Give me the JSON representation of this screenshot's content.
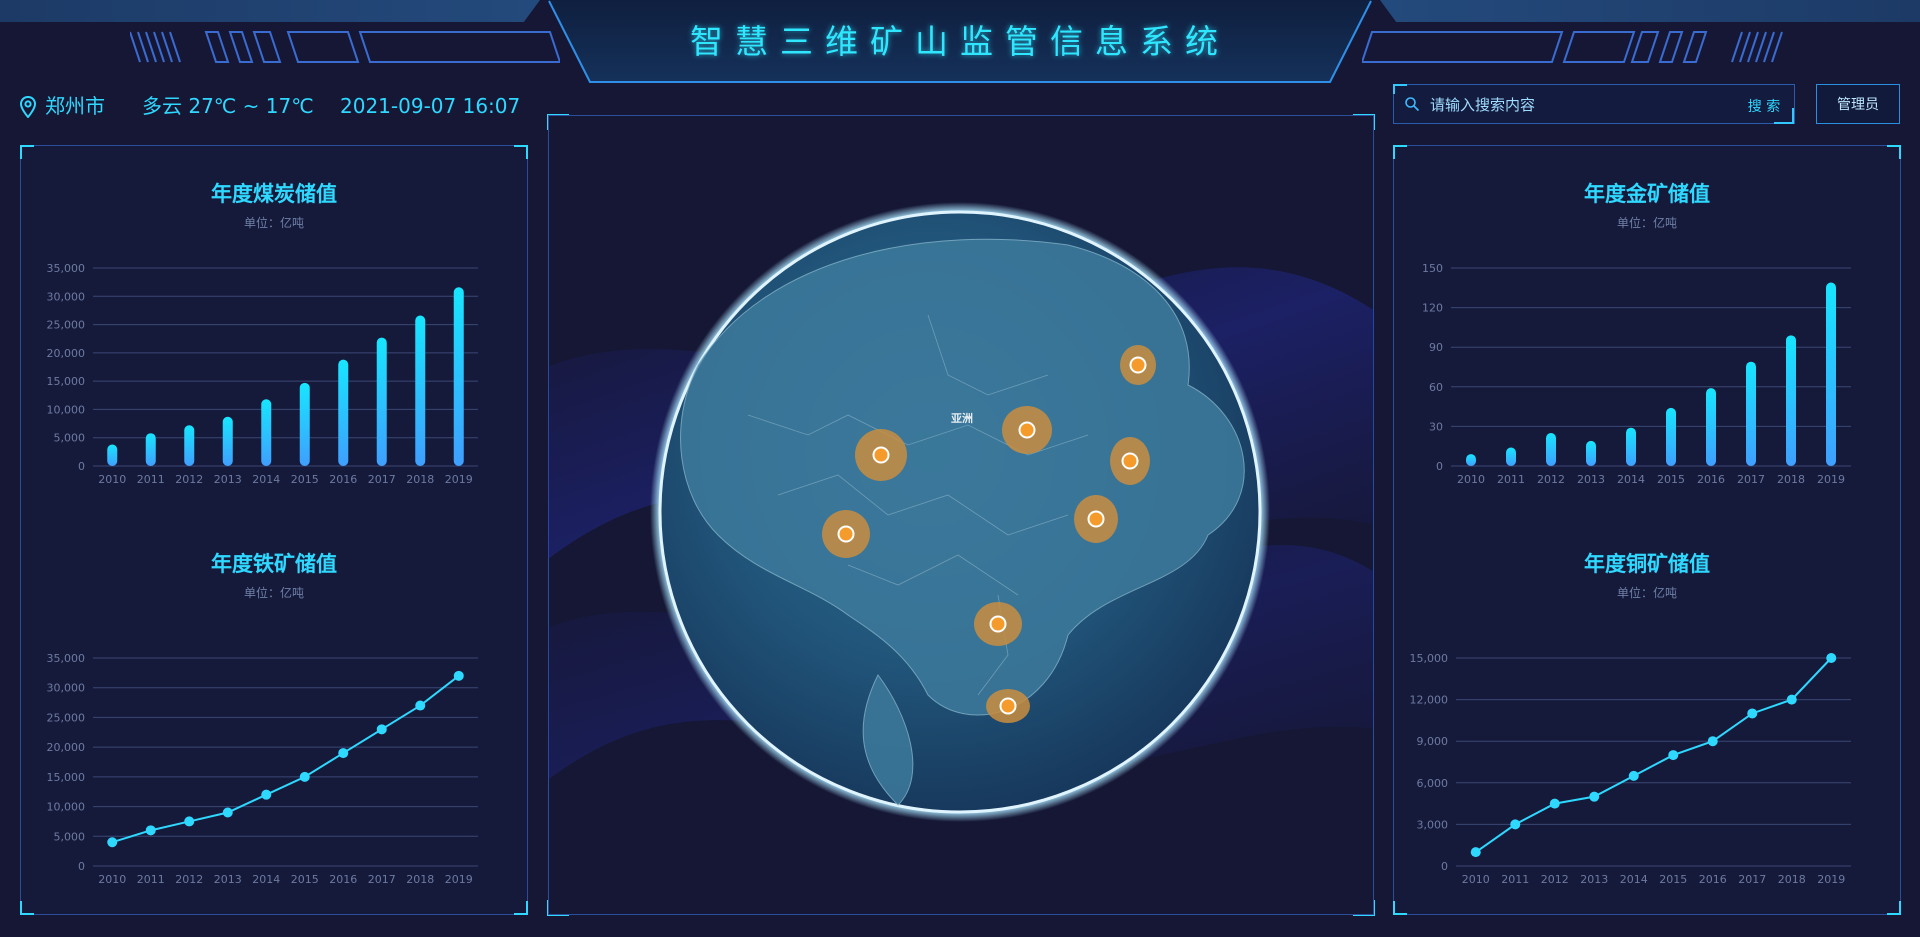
{
  "header": {
    "title": "智慧三维矿山监管信息系统"
  },
  "info": {
    "city": "郑州市",
    "weather": "多云 27℃ ~ 17℃",
    "datetime": "2021-09-07 16:07"
  },
  "search": {
    "placeholder": "请输入搜索内容",
    "button_label": "搜 索"
  },
  "admin": {
    "label": "管理员"
  },
  "globe": {
    "label": "亚洲",
    "marker_count": 8
  },
  "colors": {
    "accent": "#2fd8ff",
    "bar_top": "#17e6ff",
    "bar_bottom": "#3f9fff",
    "marker": "#f59b2b",
    "grid": "#3a4775"
  },
  "chart_data": [
    {
      "id": "coal",
      "type": "bar",
      "title": "年度煤炭储值",
      "unit": "单位：亿吨",
      "categories": [
        "2010",
        "2011",
        "2012",
        "2013",
        "2014",
        "2015",
        "2016",
        "2017",
        "2018",
        "2019"
      ],
      "values": [
        3800,
        5800,
        7200,
        8700,
        11800,
        14700,
        18800,
        22700,
        26600,
        31600
      ],
      "ylim": [
        0,
        35000
      ],
      "yticks": [
        "0",
        "5,000",
        "10,000",
        "15,000",
        "20,000",
        "25,000",
        "30,000",
        "35,000"
      ]
    },
    {
      "id": "iron",
      "type": "line",
      "title": "年度铁矿储值",
      "unit": "单位：亿吨",
      "categories": [
        "2010",
        "2011",
        "2012",
        "2013",
        "2014",
        "2015",
        "2016",
        "2017",
        "2018",
        "2019"
      ],
      "values": [
        4000,
        6000,
        7500,
        9000,
        12000,
        15000,
        19000,
        23000,
        27000,
        32000
      ],
      "ylim": [
        0,
        35000
      ],
      "yticks": [
        "0",
        "5,000",
        "10,000",
        "15,000",
        "20,000",
        "25,000",
        "30,000",
        "35,000"
      ]
    },
    {
      "id": "gold",
      "type": "bar",
      "title": "年度金矿储值",
      "unit": "单位：亿吨",
      "categories": [
        "2010",
        "2011",
        "2012",
        "2013",
        "2014",
        "2015",
        "2016",
        "2017",
        "2018",
        "2019"
      ],
      "values": [
        9,
        14,
        25,
        19,
        29,
        44,
        59,
        79,
        99,
        139
      ],
      "ylim": [
        0,
        150
      ],
      "yticks": [
        "0",
        "30",
        "60",
        "90",
        "120",
        "150"
      ]
    },
    {
      "id": "copper",
      "type": "line",
      "title": "年度铜矿储值",
      "unit": "单位：亿吨",
      "categories": [
        "2010",
        "2011",
        "2012",
        "2013",
        "2014",
        "2015",
        "2016",
        "2017",
        "2018",
        "2019"
      ],
      "values": [
        1000,
        3000,
        4500,
        5000,
        6500,
        8000,
        9000,
        11000,
        12000,
        15000
      ],
      "ylim": [
        0,
        15000
      ],
      "yticks": [
        "0",
        "3,000",
        "6,000",
        "9,000",
        "12,000",
        "15,000"
      ]
    }
  ]
}
